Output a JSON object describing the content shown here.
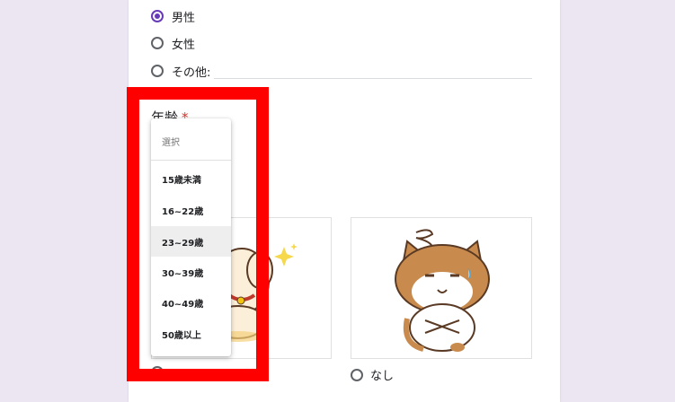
{
  "gender_options": [
    {
      "label": "男性",
      "checked": true
    },
    {
      "label": "女性",
      "checked": false
    },
    {
      "label": "その他:",
      "checked": false
    }
  ],
  "age_question": {
    "title": "年齢",
    "required_mark": "*"
  },
  "age_dropdown": {
    "placeholder": "選択",
    "options": [
      "15歳未満",
      "16~22歳",
      "23~29歳",
      "30~39歳",
      "40~49歳",
      "50歳以上"
    ],
    "hovered_option": "23~29歳"
  },
  "image_options": [
    {
      "label": "",
      "image": "dog-illustration"
    },
    {
      "label": "なし",
      "image": "cat-illustration"
    }
  ],
  "colors": {
    "accent": "#673ab7",
    "highlight": "#ff0000",
    "background": "#ece6f3",
    "required": "#d93025"
  }
}
